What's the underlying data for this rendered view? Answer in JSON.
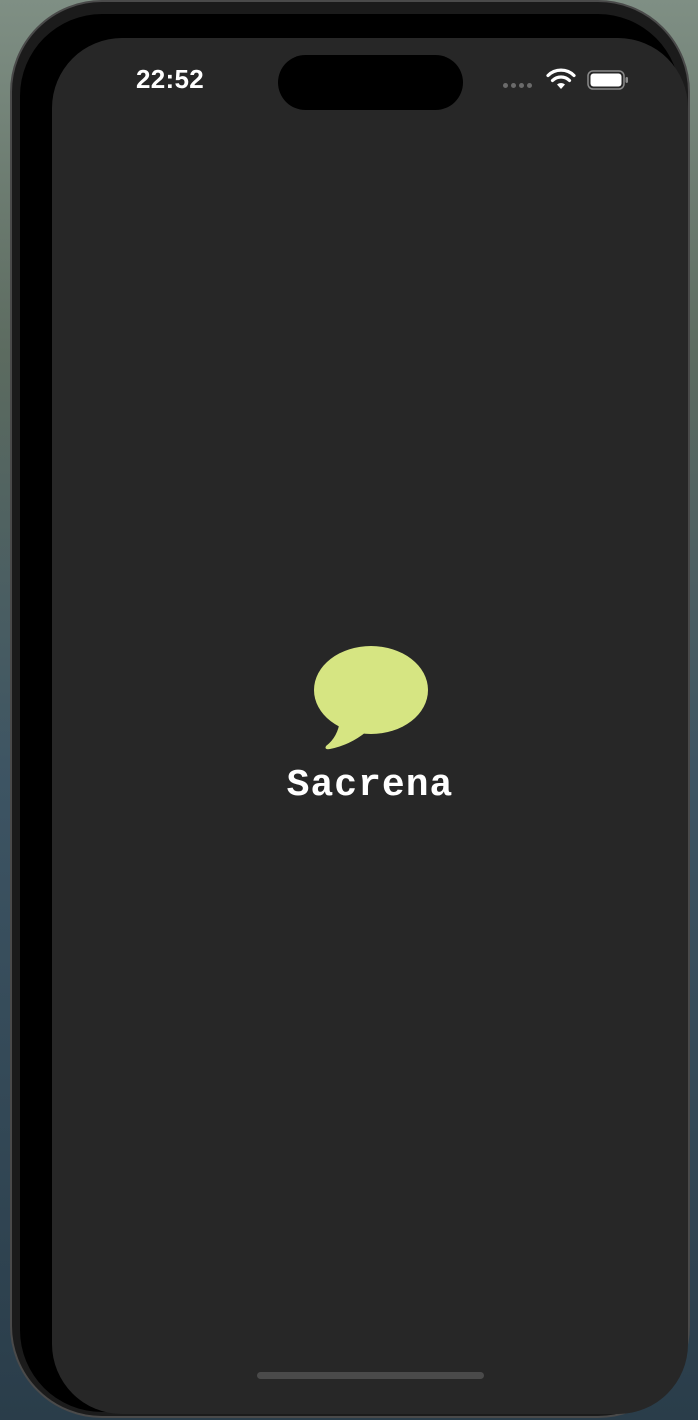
{
  "status_bar": {
    "time": "22:52",
    "signal_icon": "cellular-dots-icon",
    "wifi_icon": "wifi-icon",
    "battery_icon": "battery-full-icon"
  },
  "splash": {
    "logo_icon": "speech-bubble-icon",
    "logo_color": "#d6e582",
    "app_name": "Sacrena"
  },
  "colors": {
    "screen_background": "#272727",
    "text": "#ffffff"
  }
}
